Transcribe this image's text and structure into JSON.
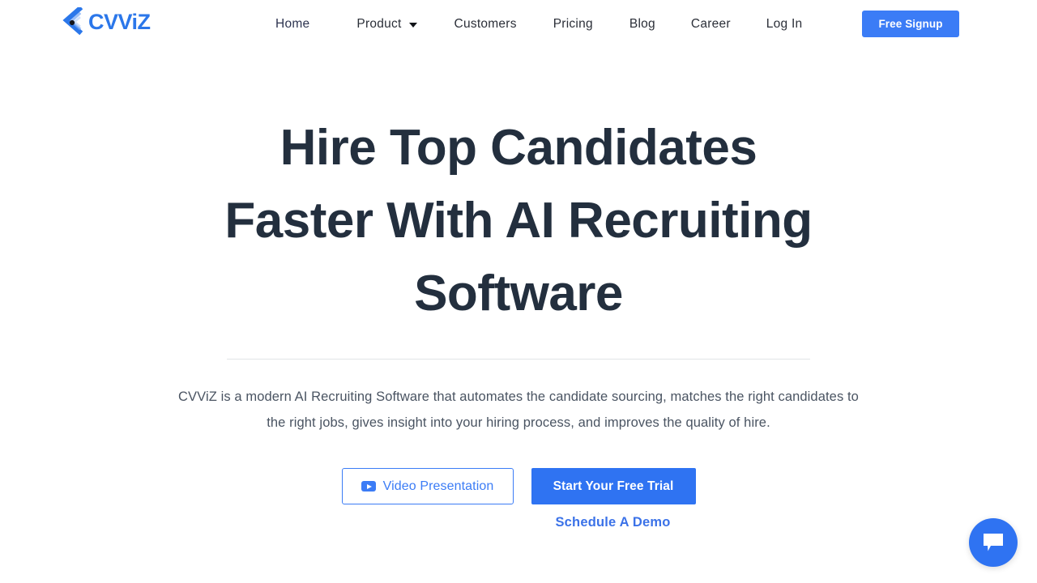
{
  "header": {
    "brand": {
      "name": "CVViZ",
      "logo_icon": "cvviz-chevron-logo",
      "color": "#2b77ea"
    },
    "nav": [
      {
        "label": "Home",
        "icon": null,
        "active": true
      },
      {
        "label": "Product",
        "icon": "chevron-down-icon",
        "active": false
      },
      {
        "label": "Customers",
        "icon": null,
        "active": false
      },
      {
        "label": "Pricing",
        "icon": null,
        "active": false
      },
      {
        "label": "Blog",
        "icon": null,
        "active": false
      },
      {
        "label": "Career",
        "icon": null,
        "active": false
      },
      {
        "label": "Log In",
        "icon": null,
        "active": false
      }
    ],
    "signup_button": {
      "label": "Free Signup",
      "background": "#3b7cf6",
      "text_color": "#ffffff"
    }
  },
  "hero": {
    "headline_line1": "Hire Top Candidates",
    "headline_line2": "Faster With AI Recruiting",
    "headline_line3": "Software",
    "headline_color": "#232f3e",
    "subheadline": "CVViZ is a modern AI Recruiting Software that automates the candidate sourcing, matches the right candidates to the right jobs, gives insight into your hiring process, and improves the quality of hire.",
    "cta": {
      "video_button": {
        "label": "Video Presentation",
        "icon": "youtube-play-icon",
        "border_color": "#3b7cf6",
        "text_color": "#3b7cf6"
      },
      "trial_button": {
        "label": "Start Your Free Trial",
        "background": "#2f73f2",
        "text_color": "#ffffff"
      },
      "demo_link": {
        "label": "Schedule A Demo",
        "color": "#3b72e8"
      }
    }
  },
  "chat_widget": {
    "icon": "chat-bubble-icon",
    "background": "#2f73f2"
  }
}
